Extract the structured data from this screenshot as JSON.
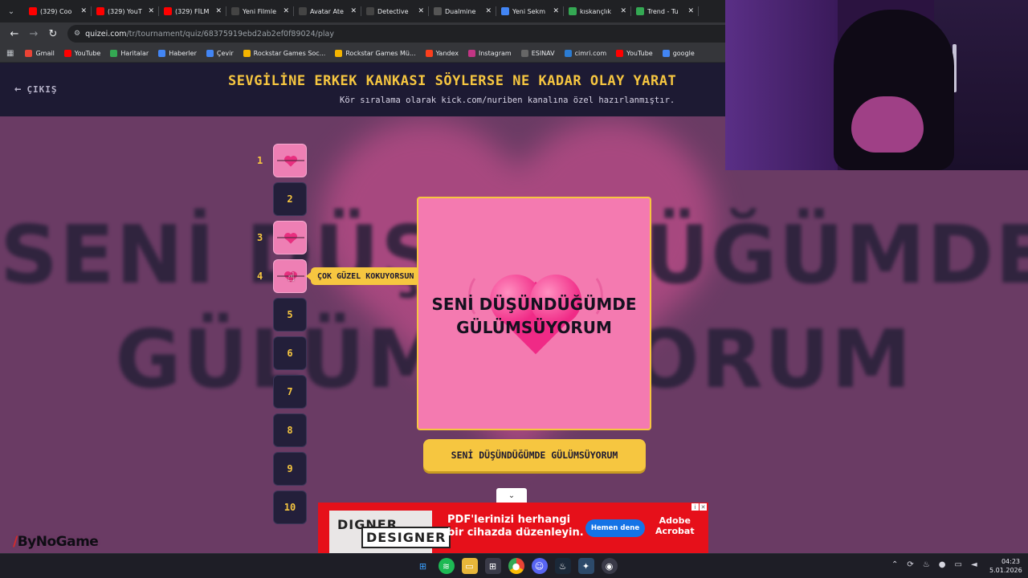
{
  "browser": {
    "tabs": [
      {
        "label": "(329) Coo",
        "icon": "youtube-icon",
        "color": "#ff0000"
      },
      {
        "label": "(329) YouT",
        "icon": "youtube-icon",
        "color": "#ff0000"
      },
      {
        "label": "(329) FİLM",
        "icon": "youtube-icon",
        "color": "#ff0000"
      },
      {
        "label": "Yeni Filmle",
        "icon": "openai-icon",
        "color": "#444444"
      },
      {
        "label": "Avatar Ate",
        "icon": "openai-icon",
        "color": "#444444"
      },
      {
        "label": "Detective",
        "icon": "openai-icon",
        "color": "#444444"
      },
      {
        "label": "Dualmine",
        "icon": "dualmine-icon",
        "color": "#555555"
      },
      {
        "label": "Yeni Sekm",
        "icon": "chrome-icon",
        "color": "#4285f4"
      },
      {
        "label": "kıskançlık",
        "icon": "trends-icon",
        "color": "#34a853"
      },
      {
        "label": "Trend - Tu",
        "icon": "trends-icon",
        "color": "#34a853"
      }
    ],
    "url_host": "quizei.com",
    "url_path": "/tr/tournament/quiz/68375919ebd2ab2ef0f89024/play",
    "bookmarks": [
      {
        "label": "Gmail",
        "color": "#ea4335"
      },
      {
        "label": "YouTube",
        "color": "#ff0000"
      },
      {
        "label": "Haritalar",
        "color": "#34a853"
      },
      {
        "label": "Haberler",
        "color": "#4285f4"
      },
      {
        "label": "Çevir",
        "color": "#4285f4"
      },
      {
        "label": "Rockstar Games Soc...",
        "color": "#f4b400"
      },
      {
        "label": "Rockstar Games Mü...",
        "color": "#f4b400"
      },
      {
        "label": "Yandex",
        "color": "#fc3f1d"
      },
      {
        "label": "Instagram",
        "color": "#c13584"
      },
      {
        "label": "ESINAV",
        "color": "#666666"
      },
      {
        "label": "cimri.com",
        "color": "#2b7cd3"
      },
      {
        "label": "YouTube",
        "color": "#ff0000"
      },
      {
        "label": "google",
        "color": "#4285f4"
      }
    ]
  },
  "header": {
    "exit_label": "ÇIKIŞ",
    "title": "SEVGİLİNE ERKEK KANKASI SÖYLERSE NE KADAR OLAY YARAT",
    "subtitle": "Kör sıralama olarak kick.com/nuriben kanalına özel hazırlanmıştır."
  },
  "background_text": {
    "line1": "SENİ DÜŞÜNDÜĞÜMDE",
    "line2": "GÜLÜMSÜYORUM"
  },
  "ranks": [
    {
      "num": "1",
      "filled": true
    },
    {
      "num": "2",
      "filled": false
    },
    {
      "num": "3",
      "filled": true
    },
    {
      "num": "4",
      "filled": true
    },
    {
      "num": "5",
      "filled": false
    },
    {
      "num": "6",
      "filled": false
    },
    {
      "num": "7",
      "filled": false
    },
    {
      "num": "8",
      "filled": false
    },
    {
      "num": "9",
      "filled": false
    },
    {
      "num": "10",
      "filled": false
    }
  ],
  "tooltip": "ÇOK GÜZEL KOKUYORSUN",
  "card": {
    "line1": "SENİ DÜŞÜNDÜĞÜMDE",
    "line2": "GÜLÜMSÜYORUM"
  },
  "choice_button": "SENİ DÜŞÜNDÜĞÜMDE GÜLÜMSÜYORUM",
  "ad": {
    "img_text": "DESIGNER",
    "img_text_top": "DIGNER",
    "line1": "PDF'lerinizi herhangi",
    "line2": "bir cihazda düzenleyin.",
    "cta": "Hemen dene",
    "brand1": "Adobe",
    "brand2": "Acrobat"
  },
  "watermark": "ByNoGame",
  "clock": {
    "time": "04:23",
    "date": "5.01.2026"
  },
  "colors": {
    "accent": "#f6c640",
    "card_pink": "#f47ab0",
    "page_bg": "#6a3b64"
  }
}
